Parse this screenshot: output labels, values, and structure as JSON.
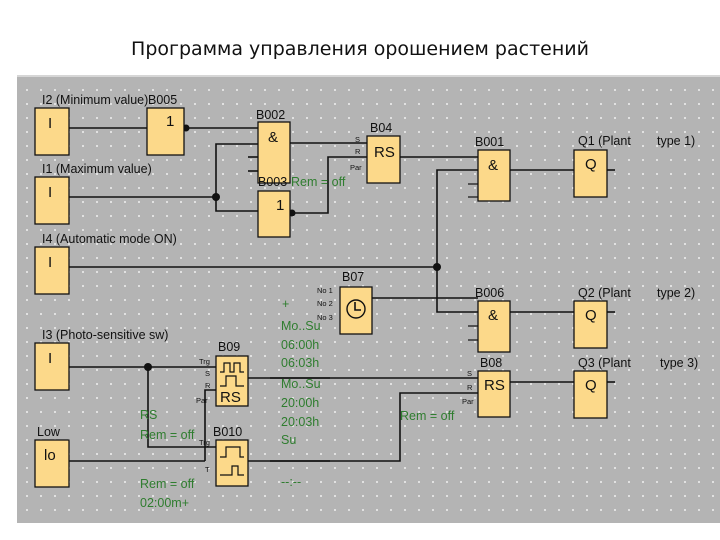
{
  "slide": {
    "title": "Программа управления орошением растений"
  },
  "diagram": {
    "inputs": [
      {
        "id": "I2",
        "label": "I2 (Minimum value)",
        "symbol": "I"
      },
      {
        "id": "I1",
        "label": "I1 (Maximum value)",
        "symbol": "I"
      },
      {
        "id": "I4",
        "label": "I4 (Automatic mode ON)",
        "symbol": "I"
      },
      {
        "id": "I3",
        "label": "I3 (Photo-sensitive sw)",
        "symbol": "I"
      },
      {
        "id": "Low",
        "label": "Low",
        "symbol": "lo"
      }
    ],
    "blocks": {
      "B005": {
        "name": "B005",
        "symbol": "1"
      },
      "B002": {
        "name": "B002",
        "symbol": "&"
      },
      "B003": {
        "name": "B003",
        "symbol": "1",
        "param": "Rem = off"
      },
      "B04": {
        "name": "B04",
        "symbol": "RS",
        "pins": [
          "S",
          "R",
          "Par"
        ]
      },
      "B001": {
        "name": "B001",
        "symbol": "&"
      },
      "B07": {
        "name": "B07",
        "symbol": "clock",
        "pins": [
          "No 1",
          "No 2",
          "No 3"
        ]
      },
      "B006": {
        "name": "B006",
        "symbol": "&"
      },
      "B08": {
        "name": "B08",
        "symbol": "RS",
        "pins": [
          "S",
          "R",
          "Par"
        ],
        "param": "Rem = off"
      },
      "B09": {
        "name": "B09",
        "symbol": "RS",
        "pins": [
          "Trg",
          "S",
          "R",
          "Par"
        ],
        "params": [
          "RS",
          "Rem = off"
        ]
      },
      "B010": {
        "name": "B010",
        "pins": [
          "Trg",
          "T"
        ],
        "params": [
          "Rem = off",
          "02:00m+"
        ]
      }
    },
    "outputs": [
      {
        "id": "Q1",
        "label_left": "Q1 (Plant",
        "label_right": "type 1)",
        "symbol": "Q"
      },
      {
        "id": "Q2",
        "label_left": "Q2 (Plant",
        "label_right": "type 2)",
        "symbol": "Q"
      },
      {
        "id": "Q3",
        "label_left": "Q3 (Plant",
        "label_right": "type 3)",
        "symbol": "Q"
      }
    ],
    "timer_params": {
      "plus": "+",
      "lines": [
        "Mo..Su",
        "06:00h",
        "06:03h",
        "Mo..Su",
        "20:00h",
        "20:03h",
        "Su",
        "--:--"
      ]
    }
  }
}
